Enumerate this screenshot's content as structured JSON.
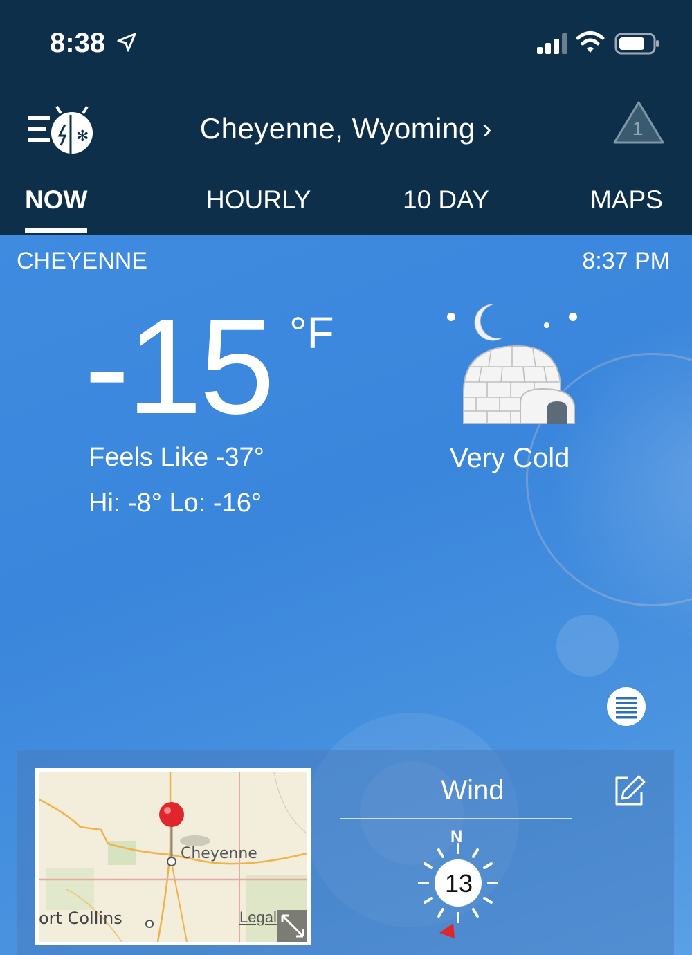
{
  "status_bar": {
    "time": "8:38"
  },
  "header": {
    "location": "Cheyenne, Wyoming",
    "location_chevron": "›",
    "alert_count": "1"
  },
  "tabs": [
    {
      "label": "NOW",
      "active": true
    },
    {
      "label": "HOURLY",
      "active": false
    },
    {
      "label": "10 DAY",
      "active": false
    },
    {
      "label": "MAPS",
      "active": false
    }
  ],
  "current": {
    "city": "CHEYENNE",
    "observed_time": "8:37 PM",
    "temperature": "-15",
    "unit": "°F",
    "feels_like": "Feels Like -37°",
    "hi_lo": "Hi: -8° Lo: -16°",
    "condition": "Very Cold",
    "condition_icon": "igloo-night-icon"
  },
  "map_card": {
    "labels": {
      "city": "Cheyenne",
      "nearby": "ort Collins",
      "legal": "Legal"
    }
  },
  "wind": {
    "title": "Wind",
    "direction_label": "N",
    "speed": "13"
  },
  "colors": {
    "header_bg": "#0d2f4a",
    "sky_blue": "#3f8be0",
    "pin_red": "#e0262b"
  }
}
